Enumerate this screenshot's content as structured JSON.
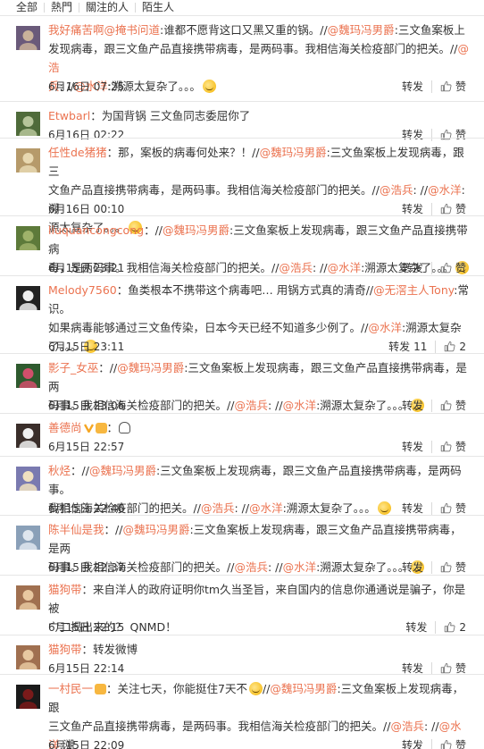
{
  "tabs": [
    "全部",
    "熱門",
    "關注的人",
    "陌生人"
  ],
  "actions": {
    "repost": "转发",
    "like": "赞"
  },
  "comments": [
    {
      "user": "我好痛苦啊",
      "sep": "：//",
      "lines": [
        [
          {
            "t": "m",
            "v": "@掩书问道"
          },
          {
            "t": "p",
            "v": ":谁都不愿背这口又黑又重的锅。//"
          },
          {
            "t": "m",
            "v": "@魏玛冯男爵"
          },
          {
            "t": "p",
            "v": ":三文鱼案板上"
          }
        ],
        [
          {
            "t": "p",
            "v": "发现病毒，跟三文鱼产品直接携带病毒，是两码事。我相信海关检疫部门的把关。//"
          },
          {
            "t": "m",
            "v": "@浩"
          }
        ],
        [
          {
            "t": "m",
            "v": "兵"
          },
          {
            "t": "p",
            "v": ":"
          },
          {
            "t": "p",
            "v": " //"
          },
          {
            "t": "m",
            "v": "@水洋"
          },
          {
            "t": "p",
            "v": ":溯源太复杂了。。。"
          },
          {
            "t": "e",
            "v": "laugh"
          }
        ]
      ],
      "time": "6月16日 07:25",
      "repost_count": "",
      "like_count": ""
    },
    {
      "user": "Etwbarl",
      "lines": [
        [
          {
            "t": "p",
            "v": "：为国背锅 三文鱼同志委屈你了"
          }
        ]
      ],
      "time": "6月16日 02:22",
      "repost_count": "",
      "like_count": ""
    },
    {
      "user": "任性de猪猪",
      "lines": [
        [
          {
            "t": "p",
            "v": "：那，案板的病毒何处来？！//"
          },
          {
            "t": "m",
            "v": "@魏玛冯男爵"
          },
          {
            "t": "p",
            "v": ":三文鱼案板上发现病毒，跟三"
          }
        ],
        [
          {
            "t": "p",
            "v": "文鱼产品直接携带病毒，是两码事。我相信海关检疫部门的把关。//"
          },
          {
            "t": "m",
            "v": "@浩兵"
          },
          {
            "t": "p",
            "v": ": //"
          },
          {
            "t": "m",
            "v": "@水洋"
          },
          {
            "t": "p",
            "v": ":溯"
          }
        ],
        [
          {
            "t": "p",
            "v": "源太复杂了。。。"
          },
          {
            "t": "e",
            "v": "laugh"
          }
        ]
      ],
      "time": "6月16日 00:10",
      "repost_count": "",
      "like_count": ""
    },
    {
      "user": "liuquancongcong",
      "lines": [
        [
          {
            "t": "p",
            "v": "：//"
          },
          {
            "t": "m",
            "v": "@魏玛冯男爵"
          },
          {
            "t": "p",
            "v": ":三文鱼案板上发现病毒，跟三文鱼产品直接携带病"
          }
        ],
        [
          {
            "t": "p",
            "v": "毒，是两码事。我相信海关检疫部门的把关。//"
          },
          {
            "t": "m",
            "v": "@浩兵"
          },
          {
            "t": "p",
            "v": ": //"
          },
          {
            "t": "m",
            "v": "@水洋"
          },
          {
            "t": "p",
            "v": ":溯源太复杂了。。。"
          },
          {
            "t": "e",
            "v": "laugh"
          }
        ]
      ],
      "time": "6月15日 23:21",
      "repost_count": "",
      "like_count": ""
    },
    {
      "user": "Melody7560",
      "lines": [
        [
          {
            "t": "p",
            "v": "：鱼类根本不携带这个病毒吧… 用锅方式真的清奇//"
          },
          {
            "t": "m",
            "v": "@无滘主人Tony"
          },
          {
            "t": "p",
            "v": ":常识。"
          }
        ],
        [
          {
            "t": "p",
            "v": "如果病毒能够通过三文鱼传染，日本今天已经不知道多少例了。//"
          },
          {
            "t": "m",
            "v": "@水洋"
          },
          {
            "t": "p",
            "v": ":溯源太复杂"
          }
        ],
        [
          {
            "t": "p",
            "v": "了。。。"
          },
          {
            "t": "e",
            "v": "laugh"
          }
        ]
      ],
      "time": "6月15日 23:11",
      "repost_count": "11",
      "like_count": "2"
    },
    {
      "user": "影子_女巫",
      "lines": [
        [
          {
            "t": "p",
            "v": "：//"
          },
          {
            "t": "m",
            "v": "@魏玛冯男爵"
          },
          {
            "t": "p",
            "v": ":三文鱼案板上发现病毒，跟三文鱼产品直接携带病毒，是两"
          }
        ],
        [
          {
            "t": "p",
            "v": "码事。我相信海关检疫部门的把关。//"
          },
          {
            "t": "m",
            "v": "@浩兵"
          },
          {
            "t": "p",
            "v": ": //"
          },
          {
            "t": "m",
            "v": "@水洋"
          },
          {
            "t": "p",
            "v": ":溯源太复杂了。。。"
          },
          {
            "t": "e",
            "v": "laugh"
          }
        ]
      ],
      "time": "6月15日 23:06",
      "repost_count": "",
      "like_count": ""
    },
    {
      "user": "善德尚",
      "lines": [
        [
          {
            "t": "v",
            "v": "vip"
          },
          {
            "t": "b",
            "v": "badge"
          },
          {
            "t": "p",
            "v": "："
          },
          {
            "t": "g",
            "v": "ghost"
          }
        ]
      ],
      "time": "6月15日 22:57",
      "repost_count": "",
      "like_count": ""
    },
    {
      "user": "秋烃",
      "lines": [
        [
          {
            "t": "p",
            "v": "：//"
          },
          {
            "t": "m",
            "v": "@魏玛冯男爵"
          },
          {
            "t": "p",
            "v": ":三文鱼案板上发现病毒，跟三文鱼产品直接携带病毒，是两码事。"
          }
        ],
        [
          {
            "t": "p",
            "v": "我相信海关检疫部门的把关。//"
          },
          {
            "t": "m",
            "v": "@浩兵"
          },
          {
            "t": "p",
            "v": ": //"
          },
          {
            "t": "m",
            "v": "@水洋"
          },
          {
            "t": "p",
            "v": ":溯源太复杂了。。。"
          },
          {
            "t": "e",
            "v": "laugh"
          }
        ]
      ],
      "time": "6月15日 22:46",
      "repost_count": "",
      "like_count": ""
    },
    {
      "user": "陈半仙是我",
      "lines": [
        [
          {
            "t": "p",
            "v": "：//"
          },
          {
            "t": "m",
            "v": "@魏玛冯男爵"
          },
          {
            "t": "p",
            "v": ":三文鱼案板上发现病毒，跟三文鱼产品直接携带病毒，是两"
          }
        ],
        [
          {
            "t": "p",
            "v": "码事。我相信海关检疫部门的把关。//"
          },
          {
            "t": "m",
            "v": "@浩兵"
          },
          {
            "t": "p",
            "v": ": //"
          },
          {
            "t": "m",
            "v": "@水洋"
          },
          {
            "t": "p",
            "v": ":溯源太复杂了。。。"
          },
          {
            "t": "e",
            "v": "laugh"
          }
        ]
      ],
      "time": "6月15日 22:37",
      "repost_count": "",
      "like_count": ""
    },
    {
      "user": "猫狗带",
      "lines": [
        [
          {
            "t": "p",
            "v": "：来自洋人的政府证明你tm久当圣旨，来自国内的信息你通通说是骗子，你是被"
          }
        ],
        [
          {
            "t": "p",
            "v": "宀二揭出来的？ QNMD！"
          }
        ]
      ],
      "time": "6月15日 22:15",
      "repost_count": "",
      "like_count": "2"
    },
    {
      "user": "猫狗带",
      "lines": [
        [
          {
            "t": "p",
            "v": "：转发微博"
          }
        ]
      ],
      "time": "6月15日 22:14",
      "repost_count": "",
      "like_count": ""
    },
    {
      "user": "一村民一",
      "lines": [
        [
          {
            "t": "b",
            "v": "badge"
          },
          {
            "t": "p",
            "v": "：关注七天，你能挺住7天不"
          },
          {
            "t": "e",
            "v": "laugh"
          },
          {
            "t": "p",
            "v": "//"
          },
          {
            "t": "m",
            "v": "@魏玛冯男爵"
          },
          {
            "t": "p",
            "v": ":三文鱼案板上发现病毒，跟"
          }
        ],
        [
          {
            "t": "p",
            "v": "三文鱼产品直接携带病毒，是两码事。我相信海关检疫部门的把关。//"
          },
          {
            "t": "m",
            "v": "@浩兵"
          },
          {
            "t": "p",
            "v": ": //"
          },
          {
            "t": "m",
            "v": "@水洋"
          },
          {
            "t": "p",
            "v": ":溯"
          }
        ],
        [
          {
            "t": "p",
            "v": "源太复杂了。。。"
          },
          {
            "t": "e",
            "v": "laugh"
          }
        ]
      ],
      "time": "6月15日 22:09",
      "repost_count": "",
      "like_count": ""
    }
  ],
  "colors": {
    "accent": "#eb7350",
    "text": "#333333",
    "divider": "#e6e6e6"
  },
  "icons": [
    "thumbs-up-icon",
    "laugh-emoji-icon",
    "avatar"
  ]
}
